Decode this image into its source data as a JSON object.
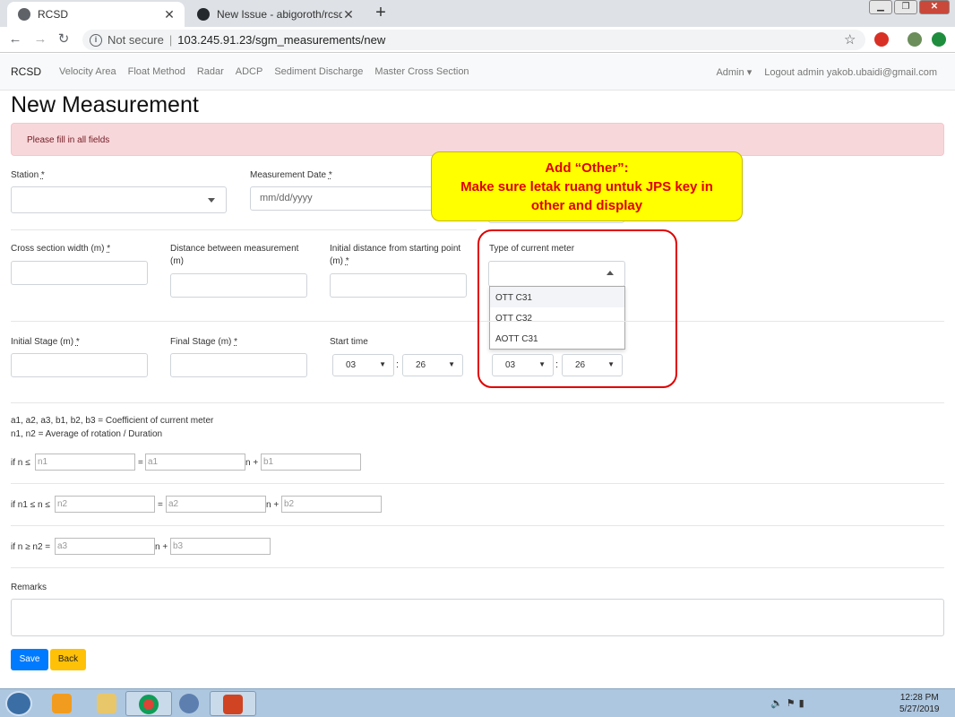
{
  "browser": {
    "tabs": [
      {
        "title": "RCSD",
        "active": true,
        "icon": "globe-icon"
      },
      {
        "title": "New Issue - abigoroth/rcsd",
        "active": false,
        "icon": "github-icon"
      }
    ],
    "security_label": "Not secure",
    "url": "103.245.91.23/sgm_measurements/new"
  },
  "appnav": {
    "brand": "RCSD",
    "links": [
      "Velocity Area",
      "Float Method",
      "Radar",
      "ADCP",
      "Sediment Discharge",
      "Master Cross Section"
    ],
    "admin_menu": "Admin",
    "logout": "Logout admin yakob.ubaidi@gmail.com"
  },
  "page": {
    "title": "New Measurement",
    "alert": "Please fill in all fields"
  },
  "form": {
    "station_label": "Station",
    "date_label": "Measurement Date",
    "date_placeholder": "mm/dd/yyyy",
    "cross_width_label": "Cross section width (m)",
    "distance_label": "Distance between measurement (m)",
    "initial_distance_label": "Initial distance from starting point (m)",
    "meter_type_label": "Type of current meter",
    "meter_options": [
      "OTT C31",
      "OTT C32",
      "AOTT C31"
    ],
    "initial_stage_label": "Initial Stage (m)",
    "final_stage_label": "Final Stage (m)",
    "start_time_label": "Start time",
    "start_hour": "03",
    "start_minute": "26",
    "end_hour": "03",
    "end_minute": "26",
    "required_mark": "*",
    "time_separator": ":"
  },
  "coefficients": {
    "note_1": "a1, a2, a3, b1, b2, b3 = Coefficient of current meter",
    "note_2": "n1, n2 = Average of rotation / Duration",
    "row1_prefix": "if n ≤",
    "row2_prefix": "if n1 ≤ n ≤",
    "row3_prefix": "if n ≥ n2 =",
    "equals": "=",
    "n_plus": "n +",
    "placeholders": {
      "n1": "n1",
      "a1": "a1",
      "b1": "b1",
      "n2": "n2",
      "a2": "a2",
      "b2": "b2",
      "a3": "a3",
      "b3": "b3"
    }
  },
  "remarks_label": "Remarks",
  "buttons": {
    "save": "Save",
    "back": "Back"
  },
  "annotation": {
    "line1": "Add “Other”:",
    "line2": "Make sure letak ruang untuk JPS key in",
    "line3": "other and display",
    "text_color": "#e00000",
    "bg_color": "#ffff00"
  },
  "taskbar": {
    "time": "12:28 PM",
    "date": "5/27/2019"
  }
}
